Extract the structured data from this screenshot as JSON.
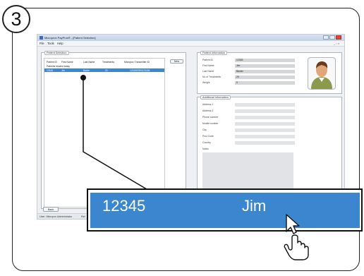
{
  "step_number": "3",
  "window": {
    "title": "Microprox PayProx® - [Patient Selection]",
    "menu": [
      "File",
      "Tools",
      "Help"
    ],
    "mdi_controls": "_ ▫ ×"
  },
  "patient_selection": {
    "title": "Patient Selection",
    "columns": [
      "Patient ID",
      "First Name",
      "Last Name",
      "Treatments",
      "Micropox Transmitter ID"
    ],
    "subheader": "Patients treated today",
    "selected_row": {
      "patient_id": "12345",
      "first_name": "Jim",
      "last_name": "Baxter",
      "treatments": "20",
      "transmitter_id": "1234567890123456"
    },
    "new_button": "New",
    "back_button": "Back"
  },
  "patient_information": {
    "title": "Patient Information",
    "fields": [
      {
        "label": "Patient ID",
        "value": "12345"
      },
      {
        "label": "First Name",
        "value": "Jim"
      },
      {
        "label": "Last Name",
        "value": "Baxter"
      },
      {
        "label": "No of Treatments",
        "value": "20"
      },
      {
        "label": "Weight",
        "value": "0"
      }
    ]
  },
  "additional_information": {
    "title": "Additional Information",
    "fields": [
      "Address 1",
      "Address 2",
      "Phone number",
      "Mobile number",
      "City",
      "Post Code",
      "Country",
      "Notes"
    ]
  },
  "status_bar": {
    "user": "User:  Micropox Administrator",
    "extra": "Ret"
  },
  "callout": {
    "patient_id": "12345",
    "first_name": "Jim"
  },
  "colors": {
    "selection": "#3b86cf",
    "frame": "#222222"
  },
  "icons": [
    "app-icon",
    "avatar-icon",
    "arrow-cursor-icon",
    "hand-cursor-icon"
  ]
}
